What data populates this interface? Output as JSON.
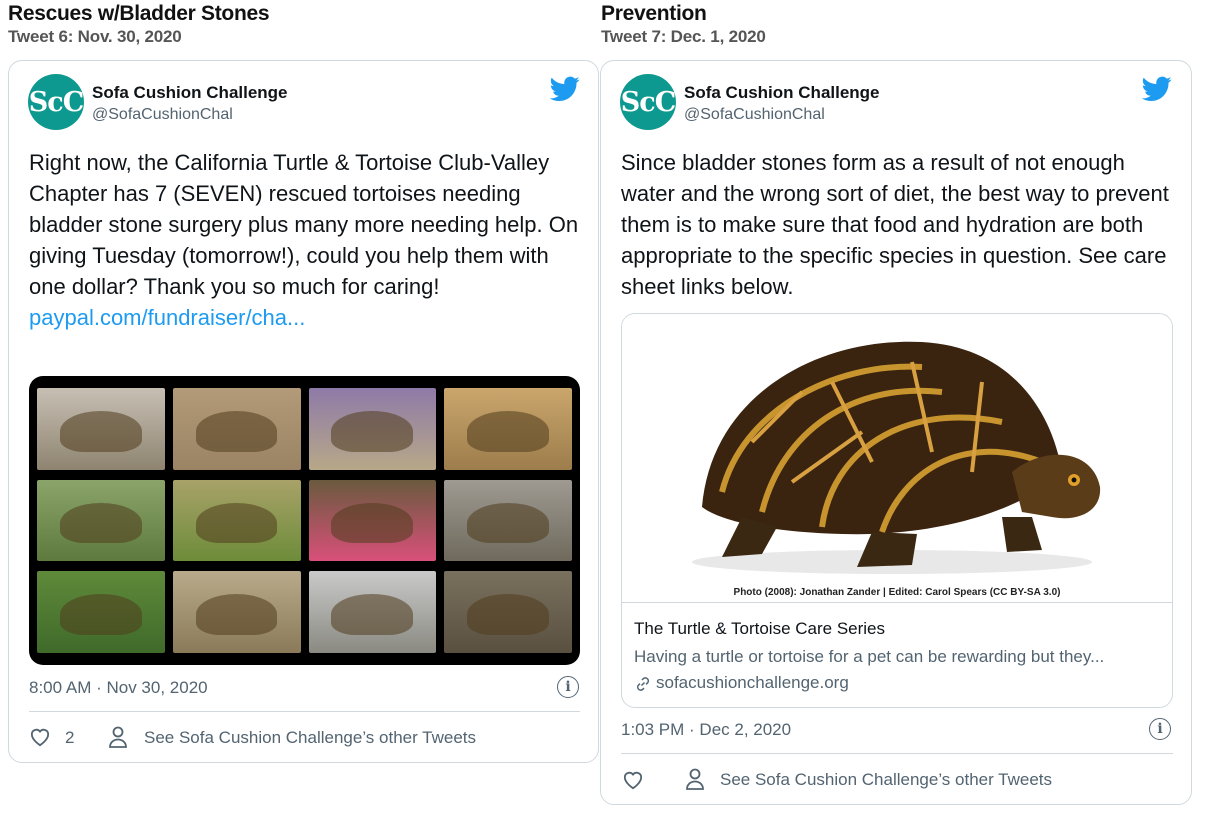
{
  "left": {
    "section_title": "Rescues w/Bladder Stones",
    "section_sub": "Tweet 6: Nov. 30, 2020",
    "tweet": {
      "avatar_text": "ScC",
      "author": "Sofa Cushion Challenge",
      "handle": "@SofaCushionChal",
      "text": "Right now, the California Turtle & Tortoise Club-Valley Chapter has 7 (SEVEN) rescued tortoises needing bladder stone surgery plus many more needing help.  On giving Tuesday (tomorrow!), could you help them with one dollar?  Thank you so much for caring!",
      "link": "paypal.com/fundraiser/cha...",
      "time": "8:00 AM · Nov 30, 2020",
      "likes": "2",
      "other_tweets": "See Sofa Cushion Challenge’s other Tweets"
    }
  },
  "right": {
    "section_title": "Prevention",
    "section_sub": "Tweet 7: Dec. 1, 2020",
    "tweet": {
      "avatar_text": "ScC",
      "author": "Sofa Cushion Challenge",
      "handle": "@SofaCushionChal",
      "text": "Since bladder stones form as a result of not enough water and the wrong sort of diet, the best way to prevent them is to make sure that food and hydration are both appropriate to the specific species in question.  See care sheet links below.",
      "card": {
        "image_caption": "Photo (2008): Jonathan Zander | Edited: Carol Spears (CC BY-SA 3.0)",
        "title": "The Turtle & Tortoise Care Series",
        "description": "Having a turtle or tortoise for a pet can be rewarding but they...",
        "domain": "sofacushionchallenge.org"
      },
      "time": "1:03 PM · Dec 2, 2020",
      "other_tweets": "See Sofa Cushion Challenge’s other Tweets"
    }
  },
  "icons": {
    "brand": "twitter-bird-icon",
    "info": "info-icon",
    "like": "heart-icon",
    "profile": "person-icon",
    "link": "link-icon"
  },
  "colors": {
    "twitter_blue": "#1d9bf0",
    "avatar_teal": "#0e9990",
    "muted": "#536471",
    "border": "#cfd9de"
  }
}
